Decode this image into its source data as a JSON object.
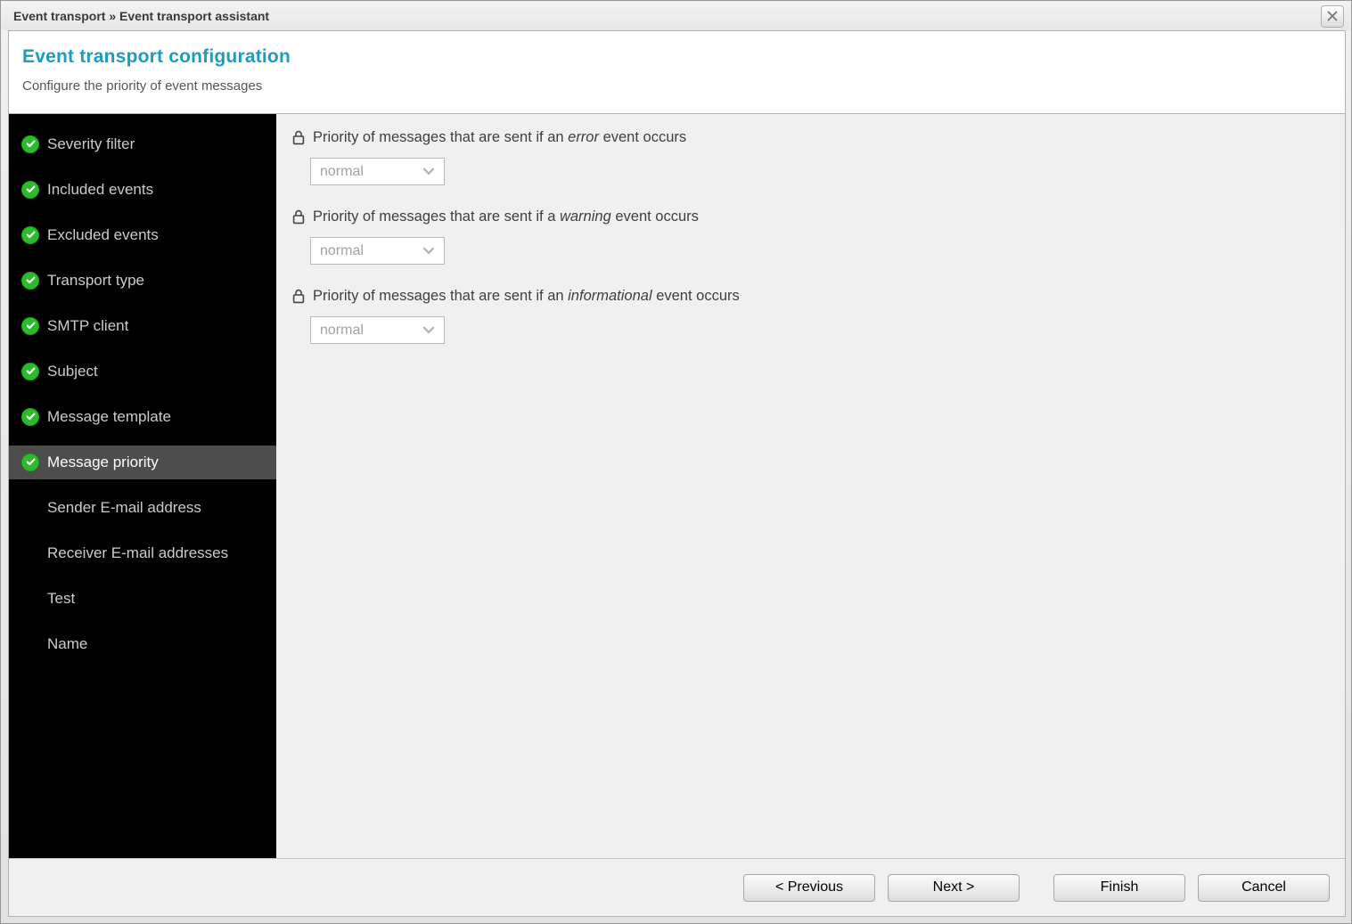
{
  "window": {
    "title": "Event transport » Event transport assistant"
  },
  "header": {
    "title": "Event transport configuration",
    "subtitle": "Configure the priority of event messages"
  },
  "sidebar": {
    "items": [
      {
        "label": "Severity filter",
        "checked": true,
        "active": false
      },
      {
        "label": "Included events",
        "checked": true,
        "active": false
      },
      {
        "label": "Excluded events",
        "checked": true,
        "active": false
      },
      {
        "label": "Transport type",
        "checked": true,
        "active": false
      },
      {
        "label": "SMTP client",
        "checked": true,
        "active": false
      },
      {
        "label": "Subject",
        "checked": true,
        "active": false
      },
      {
        "label": "Message template",
        "checked": true,
        "active": false
      },
      {
        "label": "Message priority",
        "checked": true,
        "active": true
      },
      {
        "label": "Sender E-mail address",
        "checked": false,
        "active": false
      },
      {
        "label": "Receiver E-mail addresses",
        "checked": false,
        "active": false
      },
      {
        "label": "Test",
        "checked": false,
        "active": false
      },
      {
        "label": "Name",
        "checked": false,
        "active": false
      }
    ]
  },
  "main": {
    "fields": [
      {
        "label_prefix": "Priority of messages that are sent if an ",
        "label_emphasis": "error",
        "label_suffix": " event occurs",
        "value": "normal",
        "locked": true
      },
      {
        "label_prefix": "Priority of messages that are sent if a ",
        "label_emphasis": "warning",
        "label_suffix": " event occurs",
        "value": "normal",
        "locked": true
      },
      {
        "label_prefix": "Priority of messages that are sent if an ",
        "label_emphasis": "informational",
        "label_suffix": " event occurs",
        "value": "normal",
        "locked": true
      }
    ]
  },
  "footer": {
    "buttons": [
      {
        "label": "< Previous"
      },
      {
        "label": "Next >"
      },
      {
        "label": "Finish"
      },
      {
        "label": "Cancel"
      }
    ]
  },
  "colors": {
    "accent": "#1e9bc0",
    "check_green": "#2bbb2b",
    "sidebar_bg": "#000000",
    "sidebar_active_bg": "#4d4d4d",
    "content_bg": "#f0f0f0"
  }
}
